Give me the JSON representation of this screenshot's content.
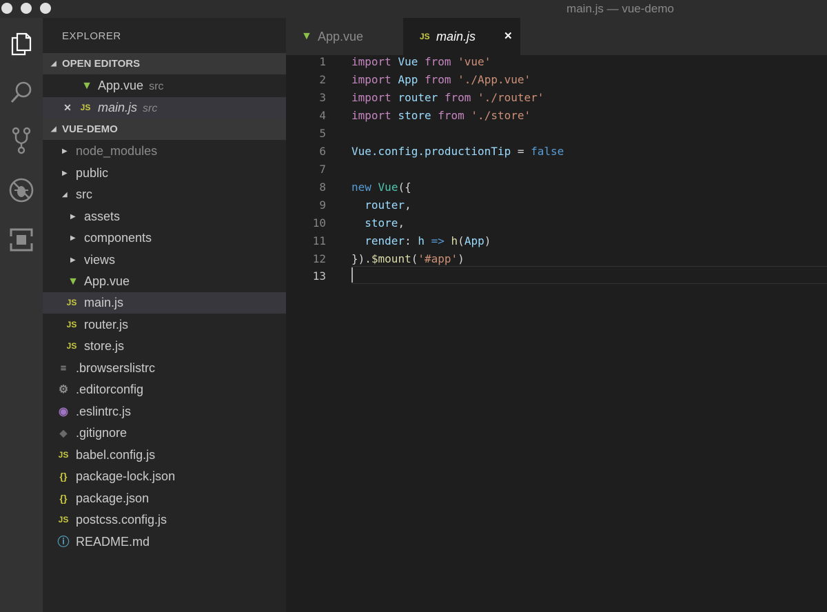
{
  "window": {
    "title": "main.js — vue-demo"
  },
  "activity_bar": {
    "items": [
      {
        "icon": "files-icon"
      },
      {
        "icon": "search-icon"
      },
      {
        "icon": "source-control-icon"
      },
      {
        "icon": "debug-icon"
      },
      {
        "icon": "extensions-icon"
      }
    ]
  },
  "sidebar": {
    "title": "EXPLORER",
    "open_editors_header": "OPEN EDITORS",
    "open_editors": [
      {
        "name": "App.vue",
        "desc": "src",
        "type": "vue"
      },
      {
        "name": "main.js",
        "desc": "src",
        "type": "js"
      }
    ],
    "project_header": "VUE-DEMO",
    "tree": [
      {
        "name": "node_modules"
      },
      {
        "name": "public"
      },
      {
        "name": "src"
      },
      {
        "name": "assets"
      },
      {
        "name": "components"
      },
      {
        "name": "views"
      },
      {
        "name": "App.vue"
      },
      {
        "name": "main.js"
      },
      {
        "name": "router.js"
      },
      {
        "name": "store.js"
      },
      {
        "name": ".browserslistrc"
      },
      {
        "name": ".editorconfig"
      },
      {
        "name": ".eslintrc.js"
      },
      {
        "name": ".gitignore"
      },
      {
        "name": "babel.config.js"
      },
      {
        "name": "package-lock.json"
      },
      {
        "name": "package.json"
      },
      {
        "name": "postcss.config.js"
      },
      {
        "name": "README.md"
      }
    ],
    "icon_glyphs": {
      "js": "JS",
      "json": "{}",
      "close": "✕"
    }
  },
  "tabs": [
    {
      "label": "App.vue",
      "active": false
    },
    {
      "label": "main.js",
      "active": true,
      "close": "✕"
    }
  ],
  "editor": {
    "line_numbers": [
      "1",
      "2",
      "3",
      "4",
      "5",
      "6",
      "7",
      "8",
      "9",
      "10",
      "11",
      "12",
      "13"
    ],
    "current_line": "13",
    "lines": {
      "l1": {
        "k": "import",
        "v": "Vue",
        "k2": "from",
        "s": "'vue'"
      },
      "l2": {
        "k": "import",
        "v": "App",
        "k2": "from",
        "s": "'./App.vue'"
      },
      "l3": {
        "k": "import",
        "v": "router",
        "k2": "from",
        "s": "'./router'"
      },
      "l4": {
        "k": "import",
        "v": "store",
        "k2": "from",
        "s": "'./store'"
      },
      "l6": {
        "a": "Vue",
        "b": ".config.productionTip",
        "eq": " = ",
        "bool": "false"
      },
      "l8": {
        "kw": "new",
        "c": "Vue",
        "p": "({"
      },
      "l9": {
        "v": "router",
        "p": ","
      },
      "l10": {
        "v": "store",
        "p": ","
      },
      "l11": {
        "v": "render",
        "p": ":",
        "h": "h",
        "arrow": "=>",
        "f": "h",
        "open": "(",
        "arg": "App",
        "close": ")"
      },
      "l12": {
        "p": "}).",
        "f": "$mount",
        "open": "(",
        "s": "'#app'",
        "close": ")"
      }
    }
  },
  "colors": {
    "js_icon": "#cbcb41",
    "vue_icon": "#8dc149",
    "keyword": "#c586c0",
    "string": "#ce9178",
    "variable": "#9cdcfe",
    "class": "#4ec9b0",
    "boolean": "#569cd6"
  }
}
